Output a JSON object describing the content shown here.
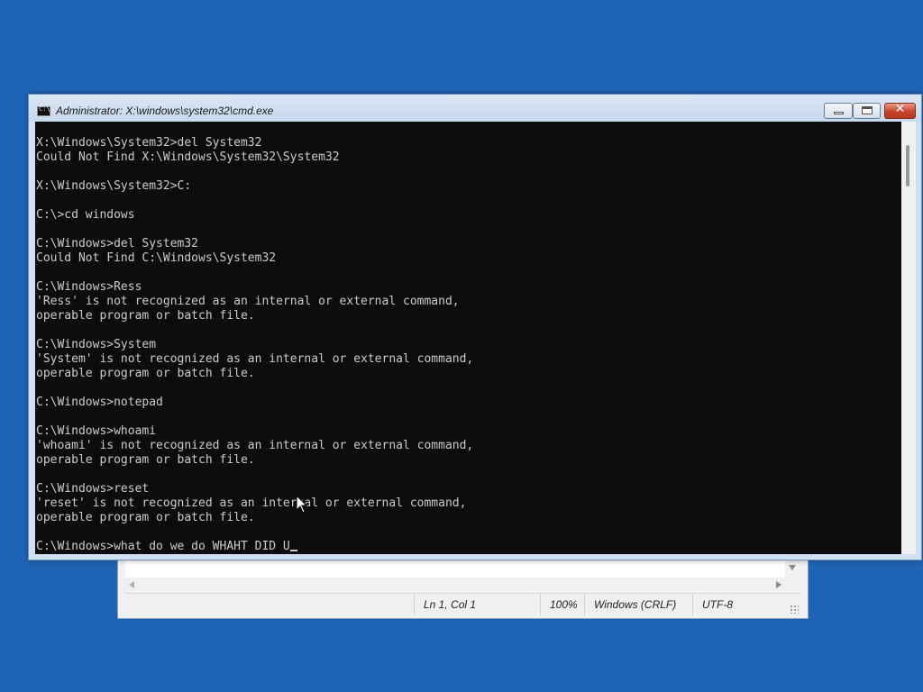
{
  "notepad": {
    "status": {
      "position": "Ln 1, Col 1",
      "zoom": "100%",
      "line_ending": "Windows (CRLF)",
      "encoding": "UTF-8"
    }
  },
  "cmd": {
    "title": "Administrator: X:\\windows\\system32\\cmd.exe",
    "console_lines": [
      "X:\\Windows\\System32>del System32",
      "Could Not Find X:\\Windows\\System32\\System32",
      "",
      "X:\\Windows\\System32>C:",
      "",
      "C:\\>cd windows",
      "",
      "C:\\Windows>del System32",
      "Could Not Find C:\\Windows\\System32",
      "",
      "C:\\Windows>Ress",
      "'Ress' is not recognized as an internal or external command,",
      "operable program or batch file.",
      "",
      "C:\\Windows>System",
      "'System' is not recognized as an internal or external command,",
      "operable program or batch file.",
      "",
      "C:\\Windows>notepad",
      "",
      "C:\\Windows>whoami",
      "'whoami' is not recognized as an internal or external command,",
      "operable program or batch file.",
      "",
      "C:\\Windows>reset",
      "'reset' is not recognized as an internal or external command,",
      "operable program or batch file.",
      ""
    ],
    "current_input": "C:\\Windows>what do we do WHAHT DID U"
  },
  "colors": {
    "desktop": "#1f64b4",
    "console_bg": "#0c0c0c",
    "console_fg": "#cccccc",
    "close_button": "#c6432c"
  },
  "icons": {
    "app": "cmd-icon",
    "minimize": "minimize-icon",
    "maximize": "maximize-icon",
    "close": "close-icon",
    "pointer": "mouse-pointer-icon"
  }
}
